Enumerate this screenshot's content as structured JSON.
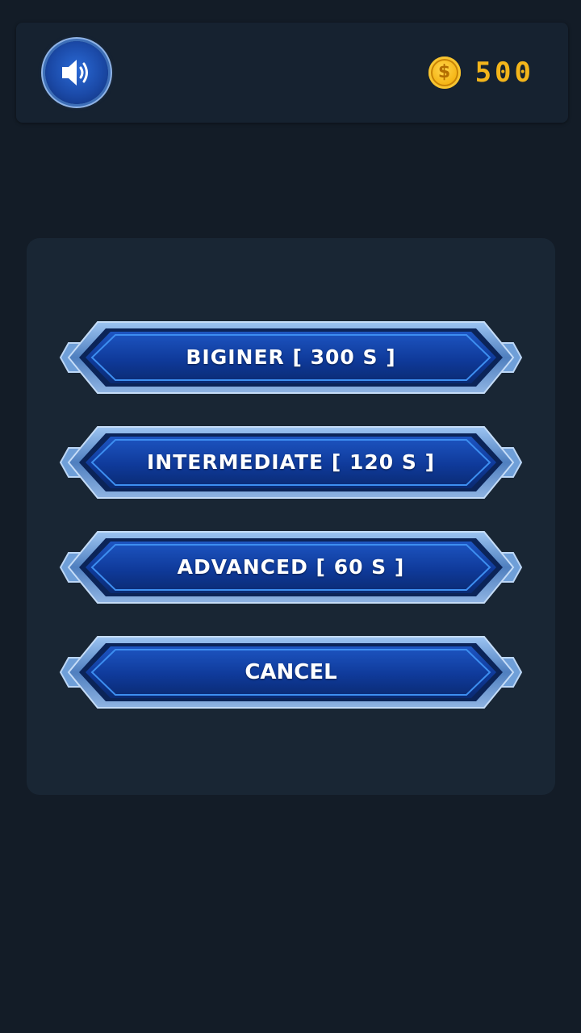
{
  "header": {
    "sound_icon": "speaker-icon",
    "coin_icon": "coin-icon",
    "coin_symbol": "$",
    "coin_amount": "500"
  },
  "menu": {
    "buttons": [
      {
        "label": "BIGINER [ 300 S ]"
      },
      {
        "label": "INTERMEDIATE [ 120 S ]"
      },
      {
        "label": "ADVANCED [ 60 S ]"
      },
      {
        "label": "CANCEL"
      }
    ]
  },
  "colors": {
    "background": "#131c27",
    "panel": "#192634",
    "coin": "#f3b51b",
    "button_blue": "#0f3a9a"
  }
}
